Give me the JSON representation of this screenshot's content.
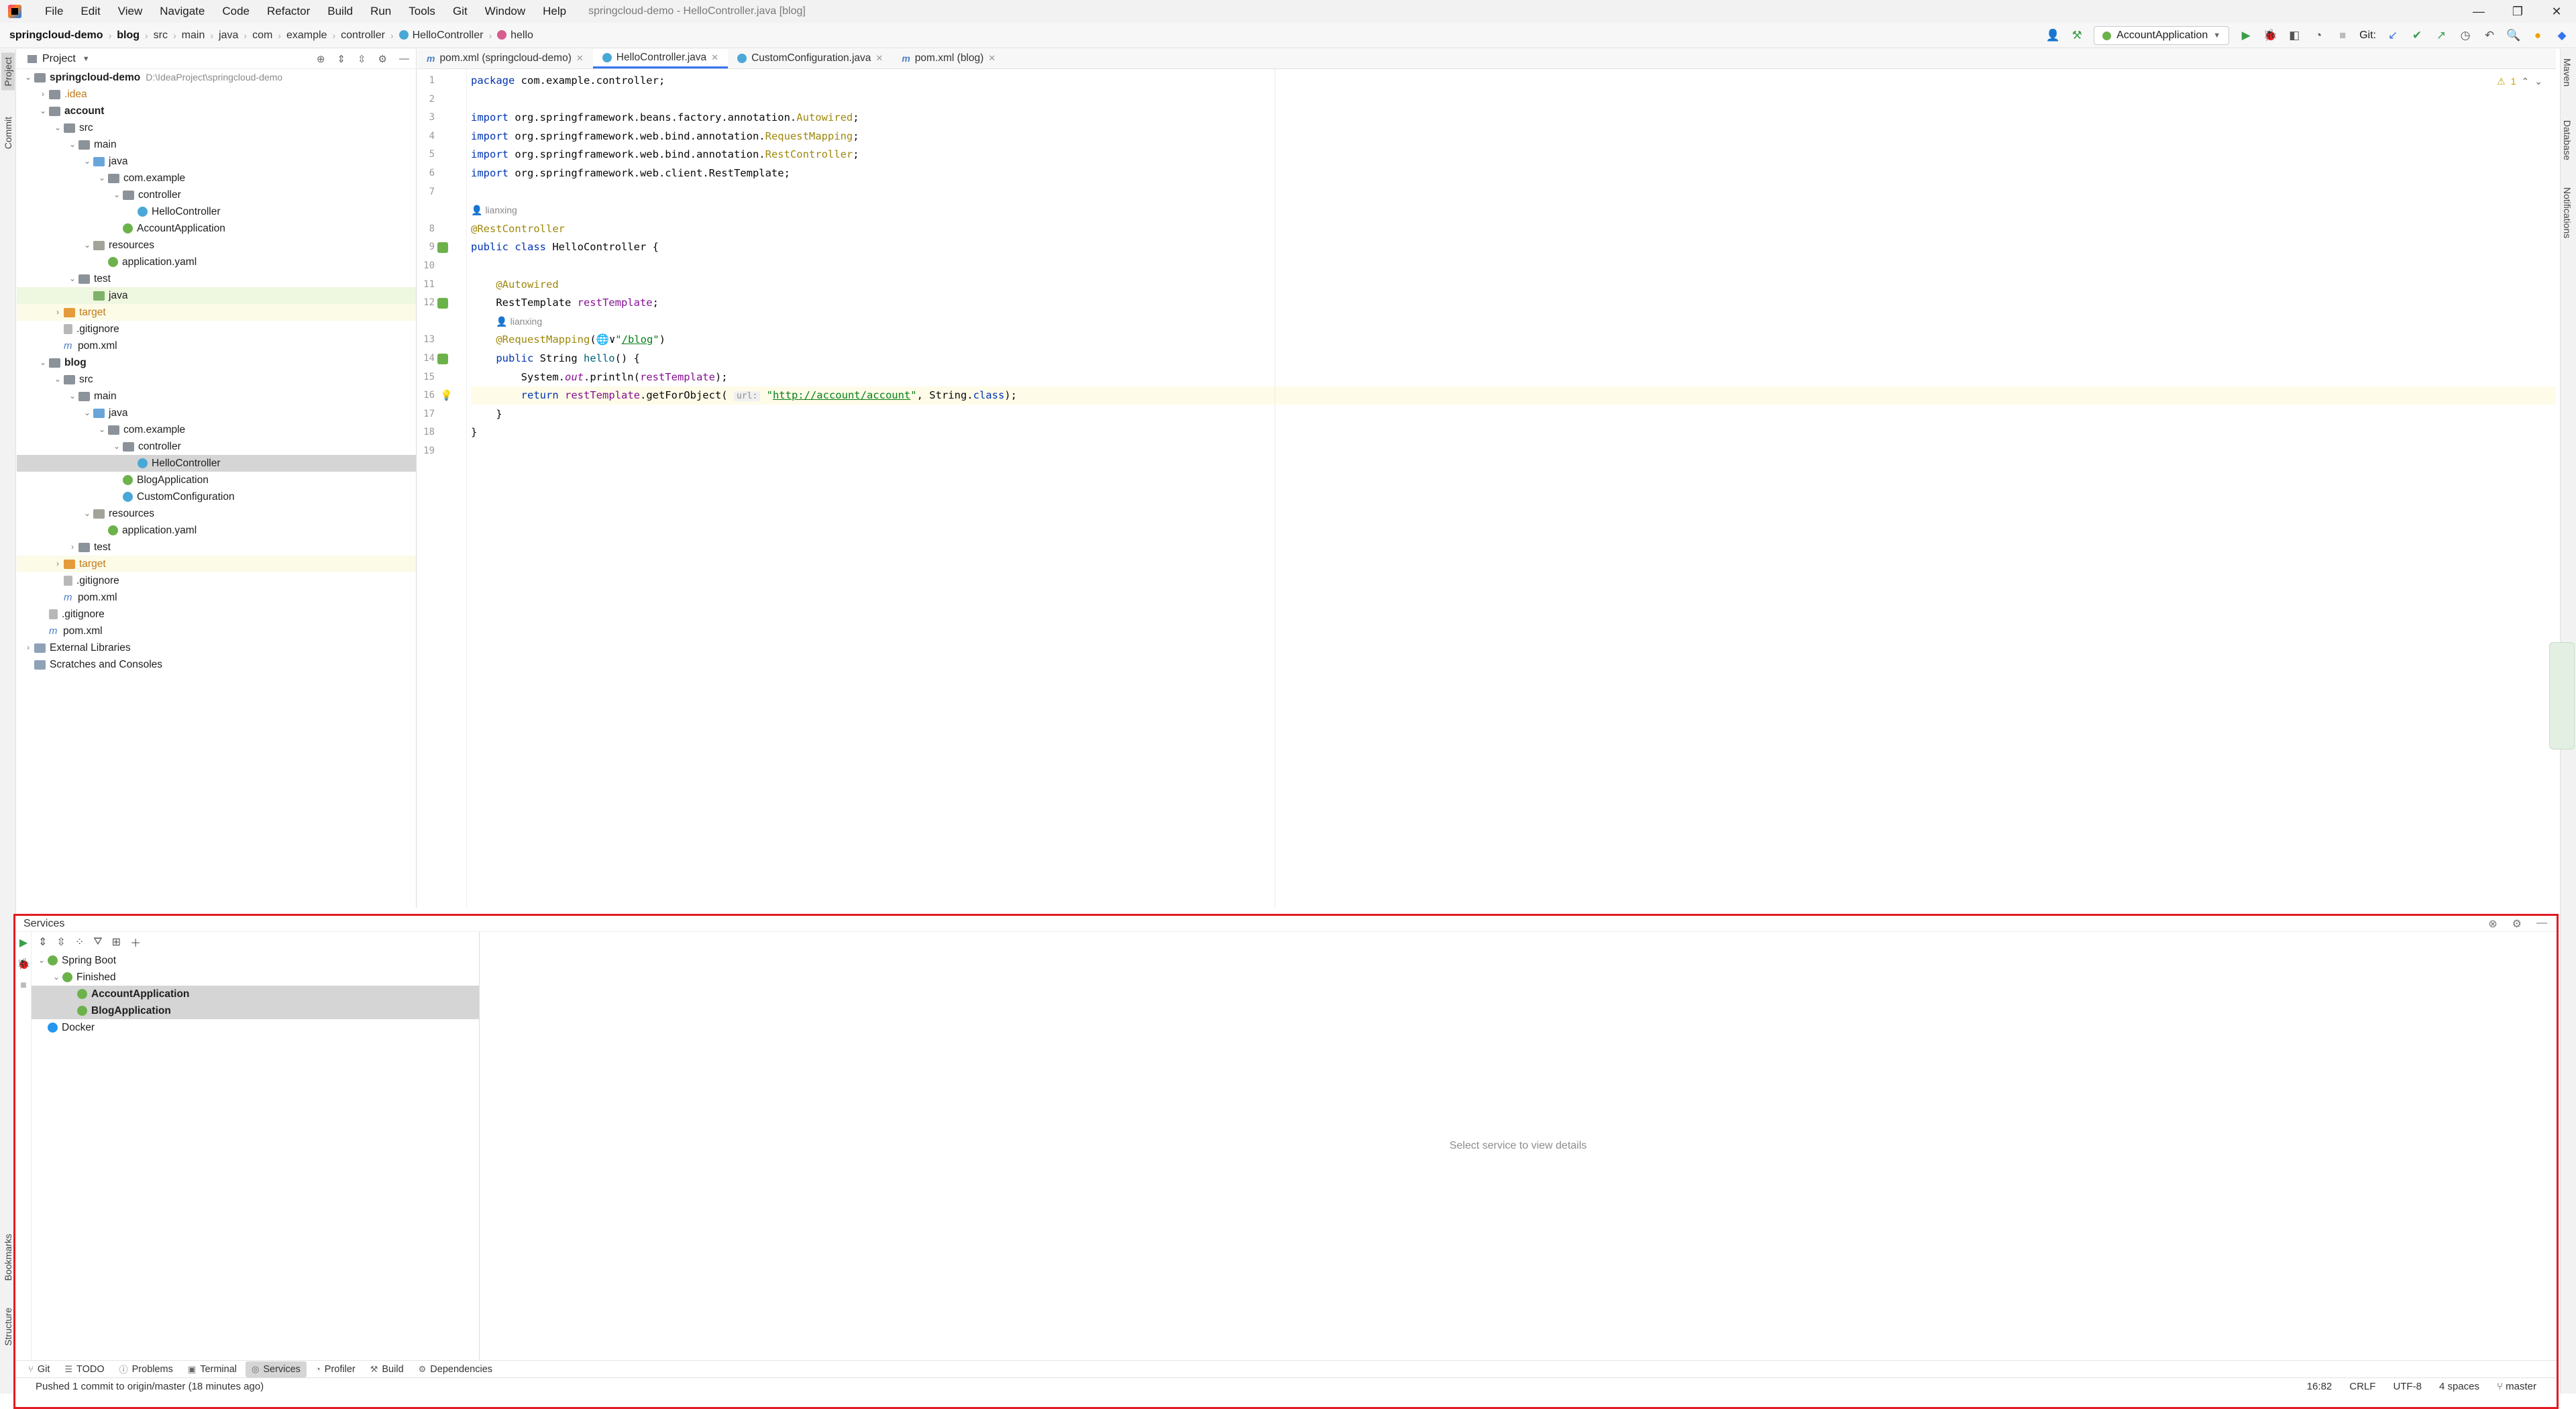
{
  "window": {
    "title": "springcloud-demo - HelloController.java [blog]",
    "menu": [
      "File",
      "Edit",
      "View",
      "Navigate",
      "Code",
      "Refactor",
      "Build",
      "Run",
      "Tools",
      "Git",
      "Window",
      "Help"
    ],
    "controls": {
      "minimize": "—",
      "restore": "❐",
      "close": "✕"
    }
  },
  "breadcrumb": [
    "springcloud-demo",
    "blog",
    "src",
    "main",
    "java",
    "com",
    "example",
    "controller",
    "HelloController",
    "hello"
  ],
  "toolbar": {
    "run_config": "AccountApplication",
    "git_label": "Git:"
  },
  "project": {
    "header": "Project",
    "tree": [
      {
        "label": "springcloud-demo",
        "extra": "D:\\IdeaProject\\springcloud-demo",
        "depth": 0,
        "arrow": "open",
        "icon": "folder",
        "bold": true
      },
      {
        "label": ".idea",
        "depth": 1,
        "arrow": "closed",
        "icon": "folder",
        "style": "orange"
      },
      {
        "label": "account",
        "depth": 1,
        "arrow": "open",
        "icon": "folder",
        "bold": true
      },
      {
        "label": "src",
        "depth": 2,
        "arrow": "open",
        "icon": "folder"
      },
      {
        "label": "main",
        "depth": 3,
        "arrow": "open",
        "icon": "folder"
      },
      {
        "label": "java",
        "depth": 4,
        "arrow": "open",
        "icon": "folder-blue"
      },
      {
        "label": "com.example",
        "depth": 5,
        "arrow": "open",
        "icon": "folder"
      },
      {
        "label": "controller",
        "depth": 6,
        "arrow": "open",
        "icon": "folder"
      },
      {
        "label": "HelloController",
        "depth": 7,
        "arrow": "none",
        "icon": "cls"
      },
      {
        "label": "AccountApplication",
        "depth": 6,
        "arrow": "none",
        "icon": "spring"
      },
      {
        "label": "resources",
        "depth": 4,
        "arrow": "open",
        "icon": "folder-res"
      },
      {
        "label": "application.yaml",
        "depth": 5,
        "arrow": "none",
        "icon": "spring"
      },
      {
        "label": "test",
        "depth": 3,
        "arrow": "open",
        "icon": "folder"
      },
      {
        "label": "java",
        "depth": 4,
        "arrow": "none",
        "icon": "folder-green",
        "hl": "green"
      },
      {
        "label": "target",
        "depth": 2,
        "arrow": "closed",
        "icon": "folder-orange",
        "style": "orange",
        "hl": "yellow"
      },
      {
        "label": ".gitignore",
        "depth": 2,
        "arrow": "none",
        "icon": "git"
      },
      {
        "label": "pom.xml",
        "depth": 2,
        "arrow": "none",
        "icon": "maven"
      },
      {
        "label": "blog",
        "depth": 1,
        "arrow": "open",
        "icon": "folder",
        "bold": true
      },
      {
        "label": "src",
        "depth": 2,
        "arrow": "open",
        "icon": "folder"
      },
      {
        "label": "main",
        "depth": 3,
        "arrow": "open",
        "icon": "folder"
      },
      {
        "label": "java",
        "depth": 4,
        "arrow": "open",
        "icon": "folder-blue"
      },
      {
        "label": "com.example",
        "depth": 5,
        "arrow": "open",
        "icon": "folder"
      },
      {
        "label": "controller",
        "depth": 6,
        "arrow": "open",
        "icon": "folder"
      },
      {
        "label": "HelloController",
        "depth": 7,
        "arrow": "none",
        "icon": "cls",
        "selected": true
      },
      {
        "label": "BlogApplication",
        "depth": 6,
        "arrow": "none",
        "icon": "spring"
      },
      {
        "label": "CustomConfiguration",
        "depth": 6,
        "arrow": "none",
        "icon": "cls"
      },
      {
        "label": "resources",
        "depth": 4,
        "arrow": "open",
        "icon": "folder-res"
      },
      {
        "label": "application.yaml",
        "depth": 5,
        "arrow": "none",
        "icon": "spring"
      },
      {
        "label": "test",
        "depth": 3,
        "arrow": "closed",
        "icon": "folder"
      },
      {
        "label": "target",
        "depth": 2,
        "arrow": "closed",
        "icon": "folder-orange",
        "style": "orange",
        "hl": "yellow"
      },
      {
        "label": ".gitignore",
        "depth": 2,
        "arrow": "none",
        "icon": "git"
      },
      {
        "label": "pom.xml",
        "depth": 2,
        "arrow": "none",
        "icon": "maven"
      },
      {
        "label": ".gitignore",
        "depth": 1,
        "arrow": "none",
        "icon": "git"
      },
      {
        "label": "pom.xml",
        "depth": 1,
        "arrow": "none",
        "icon": "maven"
      },
      {
        "label": "External Libraries",
        "depth": 0,
        "arrow": "closed",
        "icon": "lib"
      },
      {
        "label": "Scratches and Consoles",
        "depth": 0,
        "arrow": "none",
        "icon": "lib"
      }
    ]
  },
  "editor": {
    "tabs": [
      {
        "label": "pom.xml (springcloud-demo)",
        "icon": "m",
        "active": false
      },
      {
        "label": "HelloController.java",
        "icon": "c",
        "active": true
      },
      {
        "label": "CustomConfiguration.java",
        "icon": "c",
        "active": false
      },
      {
        "label": "pom.xml (blog)",
        "icon": "m",
        "active": false
      }
    ],
    "inspection_count": "1",
    "lines": [
      {
        "n": "1",
        "html": "<span class=\"kw\">package</span> com.example.controller;"
      },
      {
        "n": "2",
        "html": ""
      },
      {
        "n": "3",
        "html": "<span class=\"kw\">import</span> org.springframework.beans.factory.annotation.<span class=\"ann\">Autowired</span>;"
      },
      {
        "n": "4",
        "html": "<span class=\"kw\">import</span> org.springframework.web.bind.annotation.<span class=\"ann\">RequestMapping</span>;"
      },
      {
        "n": "5",
        "html": "<span class=\"kw\">import</span> org.springframework.web.bind.annotation.<span class=\"ann\">RestController</span>;"
      },
      {
        "n": "6",
        "html": "<span class=\"kw\">import</span> org.springframework.web.client.RestTemplate;"
      },
      {
        "n": "7",
        "html": ""
      },
      {
        "n": "",
        "html": "<span class=\"author\">👤 lianxing</span>"
      },
      {
        "n": "8",
        "html": "<span class=\"ann\">@RestController</span>"
      },
      {
        "n": "9",
        "html": "<span class=\"kw\">public class</span> HelloController {",
        "gicon": true
      },
      {
        "n": "10",
        "html": ""
      },
      {
        "n": "11",
        "html": "    <span class=\"ann\">@Autowired</span>"
      },
      {
        "n": "12",
        "html": "    RestTemplate <span class=\"fld\">restTemplate</span>;",
        "gicon": true
      },
      {
        "n": "",
        "html": "    <span class=\"author\">👤 lianxing</span>"
      },
      {
        "n": "13",
        "html": "    <span class=\"ann\">@RequestMapping</span>(🌐∨<span class=\"str\">\"<u>/blog</u>\"</span>)"
      },
      {
        "n": "14",
        "html": "    <span class=\"kw\">public</span> String <span style=\"color:#00627a\">hello</span>() {",
        "gicon": true
      },
      {
        "n": "15",
        "html": "        System.<span class=\"fld\"><i>out</i></span>.println(<span class=\"fld\">restTemplate</span>);"
      },
      {
        "n": "16",
        "html": "        <span class=\"kw\">return</span> <span class=\"fld\">restTemplate</span>.getForObject( <span class=\"hint\">url:</span> <span class=\"str\">\"<u>http://account/account</u>\"</span>, String.<span class=\"kw\">class</span>);",
        "current": true
      },
      {
        "n": "17",
        "html": "    }"
      },
      {
        "n": "18",
        "html": "}"
      },
      {
        "n": "19",
        "html": ""
      }
    ]
  },
  "services": {
    "title": "Services",
    "tree": [
      {
        "label": "Spring Boot",
        "depth": 0,
        "arrow": "open",
        "bold": false
      },
      {
        "label": "Finished",
        "depth": 1,
        "arrow": "open",
        "bold": false
      },
      {
        "label": "AccountApplication",
        "depth": 2,
        "arrow": "none",
        "bold": true,
        "selected": true
      },
      {
        "label": "BlogApplication",
        "depth": 2,
        "arrow": "none",
        "bold": true,
        "selected": true
      },
      {
        "label": "Docker",
        "depth": 0,
        "arrow": "none",
        "bold": false
      }
    ],
    "empty_text": "Select service to view details"
  },
  "tool_tabs": [
    {
      "label": "Git",
      "icon": "⑂",
      "active": false
    },
    {
      "label": "TODO",
      "icon": "☰",
      "active": false
    },
    {
      "label": "Problems",
      "icon": "ⓘ",
      "active": false
    },
    {
      "label": "Terminal",
      "icon": "▣",
      "active": false
    },
    {
      "label": "Services",
      "icon": "◎",
      "active": true
    },
    {
      "label": "Profiler",
      "icon": "◔",
      "active": false
    },
    {
      "label": "Build",
      "icon": "⚒",
      "active": false
    },
    {
      "label": "Dependencies",
      "icon": "⚙",
      "active": false
    }
  ],
  "left_vtabs": [
    "Project",
    "Commit",
    "Bookmarks",
    "Structure"
  ],
  "right_vtabs": [
    "Maven",
    "Database",
    "Notifications"
  ],
  "status": {
    "message": "Pushed 1 commit to origin/master (18 minutes ago)",
    "position": "16:82",
    "line_sep": "CRLF",
    "encoding": "UTF-8",
    "indent": "4 spaces",
    "branch": "master"
  },
  "colors": {
    "accent": "#3574f0",
    "highlight_border": "#e11b22",
    "selection": "#d5d5d5"
  }
}
